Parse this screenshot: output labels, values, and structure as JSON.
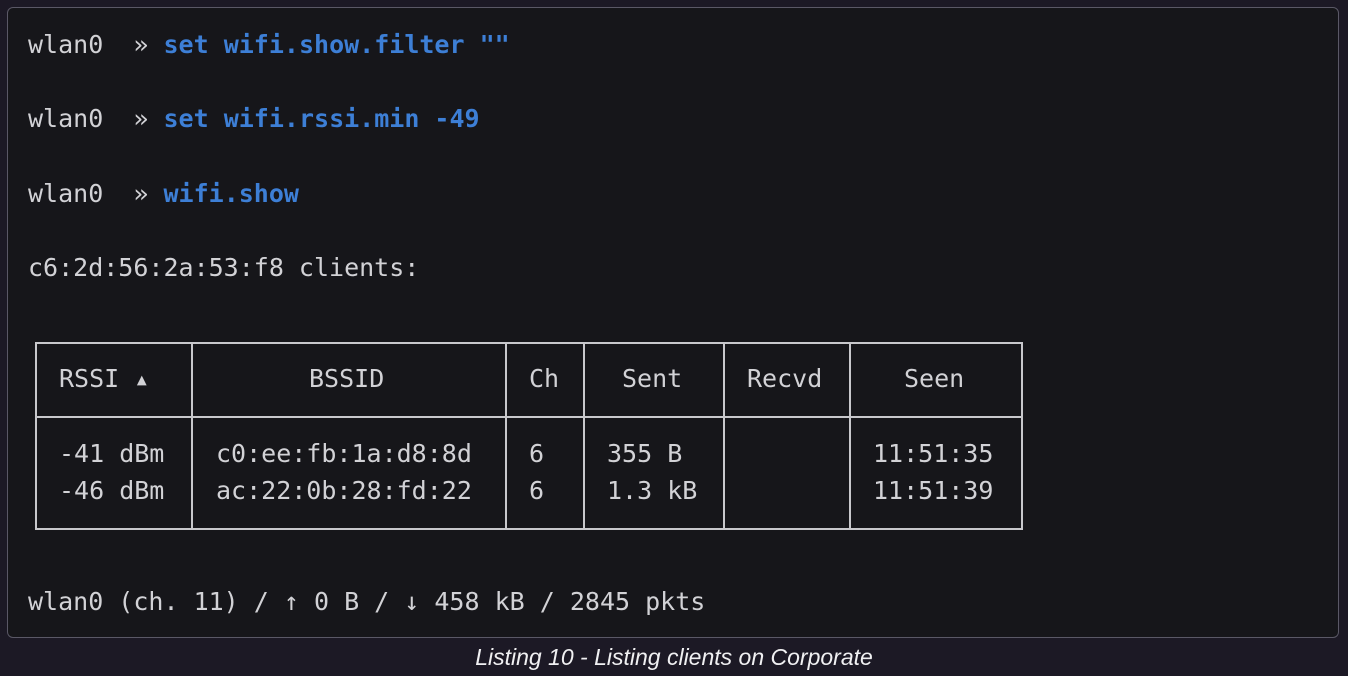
{
  "terminal": {
    "commands": [
      {
        "iface": "wlan0",
        "sep": "»",
        "cmd": "set wifi.show.filter \"\""
      },
      {
        "iface": "wlan0",
        "sep": "»",
        "cmd": "set wifi.rssi.min -49"
      },
      {
        "iface": "wlan0",
        "sep": "»",
        "cmd": "wifi.show"
      }
    ],
    "clients_header": "c6:2d:56:2a:53:f8 clients:",
    "table": {
      "headers": [
        "RSSI ▴",
        "BSSID",
        "Ch",
        "Sent",
        "Recvd",
        "Seen"
      ],
      "rows": [
        [
          "-41 dBm",
          "c0:ee:fb:1a:d8:8d",
          "6",
          "355 B",
          "",
          "11:51:35"
        ],
        [
          "-46 dBm",
          "ac:22:0b:28:fd:22",
          "6",
          "1.3 kB",
          "",
          "11:51:39"
        ]
      ]
    },
    "status_line": "wlan0 (ch. 11) / ↑ 0 B / ↓ 458 kB / 2845 pkts"
  },
  "caption": "Listing 10 - Listing clients on Corporate",
  "colors": {
    "command": "#3d7fd6",
    "text": "#d2d2d6",
    "background": "#16161a",
    "page_background": "#1c1925"
  }
}
